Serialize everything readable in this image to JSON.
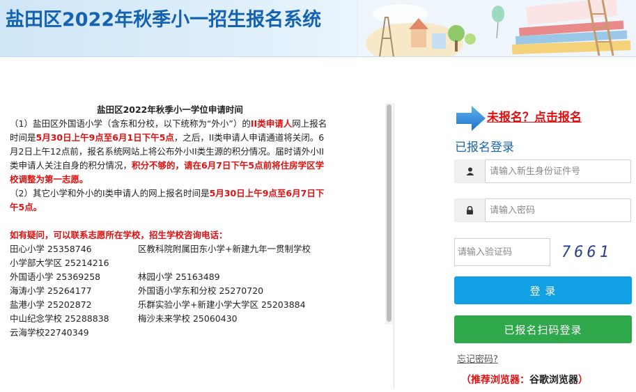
{
  "header": {
    "title": "盐田区2022年秋季小一招生报名系统"
  },
  "notice": {
    "title": "盐田区2022年秋季小一学位申请时间",
    "para1_a": "（1）盐田区外国语小学（含东和分校，以下统称为“外小”）的",
    "para1_b": "II类申请人",
    "para1_c": "网上报名时间是",
    "para1_d": "5月30日上午9点至6月1日下午5点",
    "para1_e": "，之后，II类申请人申请通道将关闭。6月2日上午12点前，报名系统网站上将公布外小II类生源的积分情况。届时请外小II类申请人关注自身的积分情况，",
    "para1_f": "积分不够的，请在6月7日下午5点前将住房学区学校调整为第一志愿。",
    "para2_a": "（2）其它小学和外小的Ⅰ类申请人的网上报名时间是",
    "para2_b": "5月30日上午9点至6月7日下午5点。",
    "contact_head": "如有疑问，可以联系志愿所在学校，招生学校咨询电话：",
    "contacts": [
      [
        "田心小学  25358746",
        "区教科院附属田东小学+新建九年一贯制学校"
      ],
      [
        "小学部大学区  25214216",
        ""
      ],
      [
        "外国语小学  25369258",
        "林园小学  25163489"
      ],
      [
        "海涛小学  25264177",
        "外国语小学东和分校  25270720"
      ],
      [
        "盐港小学  25202872",
        "乐群实验小学+新建小学大学区  25203884"
      ],
      [
        "中山纪念学校  25288838",
        "梅沙未来学校  25060430"
      ],
      [
        "云海学校22740349",
        ""
      ]
    ]
  },
  "login": {
    "register_link": "未报名？点击报名",
    "title": "已报名登录",
    "id_placeholder": "请输入新生身份证件号",
    "password_placeholder": "请输入密码",
    "captcha_placeholder": "请输入验证码",
    "captcha_text": "7661",
    "login_button": "登 录",
    "scan_button": "已报名扫码登录",
    "forgot": "忘记密码?",
    "browser_tip_open": "（推荐浏览器：",
    "browser_tip_name": "谷歌浏览器",
    "browser_tip_close": "）"
  },
  "colors": {
    "title_blue": "#1462b0",
    "red": "#e01010",
    "login_blue": "#12a0e5",
    "scan_green": "#2ea84a"
  }
}
